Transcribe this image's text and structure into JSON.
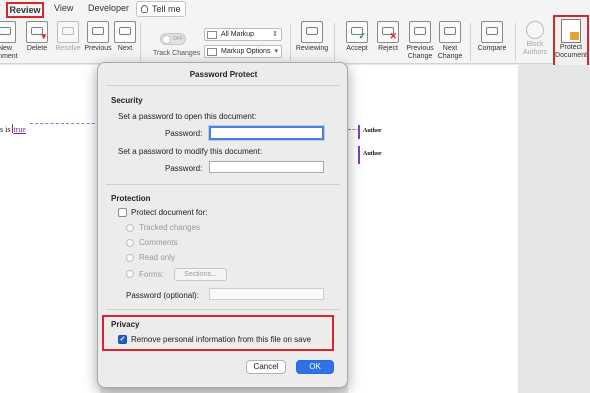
{
  "tabs": {
    "review": "Review",
    "view": "View",
    "developer": "Developer",
    "tell_me": "Tell me"
  },
  "ribbon": {
    "new_comment": "New\nomment",
    "delete": "Delete",
    "resolve": "Resolve",
    "previous": "Previous",
    "next": "Next",
    "track_toggle": "OFF",
    "track_changes": "Track Changes",
    "all_markup": "All Markup",
    "markup_options": "Markup Options",
    "reviewing": "Reviewing",
    "accept": "Accept",
    "reject": "Reject",
    "previous_change": "Previous\nChange",
    "next_change": "Next\nChange",
    "compare": "Compare",
    "block_authors": "Block\nAuthors",
    "protect_document": "Protect\nDocument"
  },
  "document": {
    "text_prefix": "s is ",
    "text_inserted": "true",
    "comment_author_1": "Author",
    "comment_author_2": "Author"
  },
  "dialog": {
    "title": "Password Protect",
    "security": {
      "heading": "Security",
      "open_label": "Set a password to open this document:",
      "open_password_label": "Password:",
      "modify_label": "Set a password to modify this document:",
      "modify_password_label": "Password:"
    },
    "protection": {
      "heading": "Protection",
      "protect_for": "Protect document for:",
      "tracked_changes": "Tracked changes",
      "comments": "Comments",
      "read_only": "Read only",
      "forms": "Forms:",
      "sections_button": "Sections...",
      "password_optional": "Password (optional):"
    },
    "privacy": {
      "heading": "Privacy",
      "remove_personal_info": "Remove personal information from this file on save",
      "remove_personal_info_checked": true
    },
    "cancel": "Cancel",
    "ok": "OK"
  },
  "colors": {
    "highlight_red": "#d9232d",
    "accent_blue": "#2f71e6",
    "markup_purple": "#7b2a9c"
  }
}
